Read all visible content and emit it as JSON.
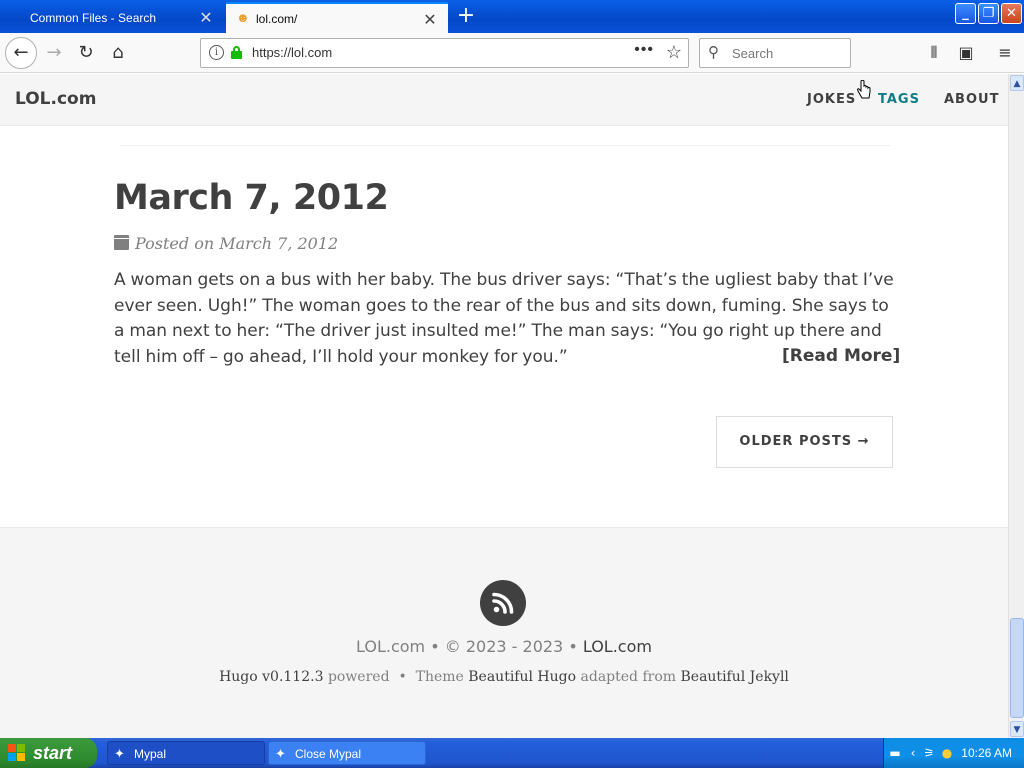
{
  "browser": {
    "tabs": [
      {
        "label": "Common Files - Search",
        "active": false
      },
      {
        "label": "lol.com/",
        "active": true
      }
    ],
    "url": "https://lol.com",
    "search_placeholder": "Search"
  },
  "site": {
    "brand": "LOL.com",
    "nav": [
      "JOKES",
      "TAGS",
      "ABOUT"
    ],
    "accent_color": "#0f7d88"
  },
  "post": {
    "title": "March 7, 2012",
    "meta": "Posted on March 7, 2012",
    "body": "A woman gets on a bus with her baby. The bus driver says: “That’s the ugliest baby that I’ve ever seen. Ugh!” The woman goes to the rear of the bus and sits down, fuming. She says to a man next to her: “The driver just insulted me!” The man says: “You go right up there and tell him off – go ahead, I’ll hold your monkey for you.”",
    "read_more": "[Read More]"
  },
  "pager": {
    "older_label": "OLDER POSTS →"
  },
  "footer": {
    "site_name": "LOL.com",
    "copyright": "• © 2023 - 2023",
    "separator": "•",
    "site_link": "LOL.com",
    "hugo_version": "Hugo v0.112.3",
    "powered": "powered",
    "theme_label": "Theme",
    "theme_name": "Beautiful Hugo",
    "adapted_from": "adapted from",
    "jekyll": "Beautiful Jekyll"
  },
  "taskbar": {
    "start_label": "start",
    "tasks": [
      "Mypal",
      "Close Mypal"
    ],
    "clock": "10:26 AM"
  }
}
